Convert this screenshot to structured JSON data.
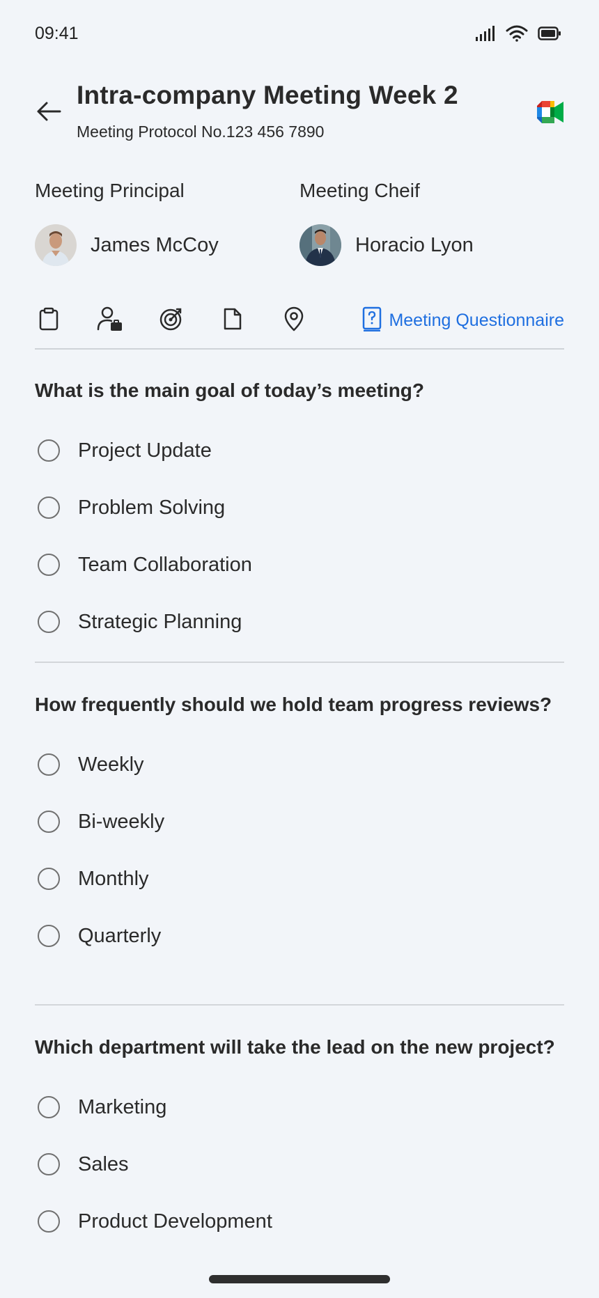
{
  "status": {
    "time": "09:41",
    "icons": [
      "signal-icon",
      "wifi-icon",
      "battery-icon"
    ]
  },
  "header": {
    "title": "Intra-company Meeting Week 2",
    "subtitle": "Meeting Protocol No.123 456 7890",
    "back_icon": "back-arrow-icon",
    "app_icon": "google-meet-icon"
  },
  "people": [
    {
      "role": "Meeting Principal",
      "name": "James McCoy"
    },
    {
      "role": "Meeting Cheif",
      "name": "Horacio Lyon"
    }
  ],
  "toolbar": {
    "icons": [
      "clipboard-icon",
      "person-briefcase-icon",
      "target-icon",
      "document-icon",
      "location-pin-icon"
    ],
    "active_tab": {
      "icon": "questionnaire-icon",
      "label": "Meeting Questionnaire"
    },
    "accent": "#1f6fe0"
  },
  "questions": [
    {
      "text": "What is the main goal of today’s meeting?",
      "options": [
        "Project Update",
        "Problem Solving",
        "Team Collaboration",
        "Strategic Planning"
      ]
    },
    {
      "text": "How frequently should we hold team progress reviews?",
      "options": [
        "Weekly",
        "Bi-weekly",
        "Monthly",
        "Quarterly"
      ]
    },
    {
      "text": "Which department will take the lead on the new project?",
      "options": [
        "Marketing",
        "Sales",
        "Product Development"
      ]
    }
  ]
}
